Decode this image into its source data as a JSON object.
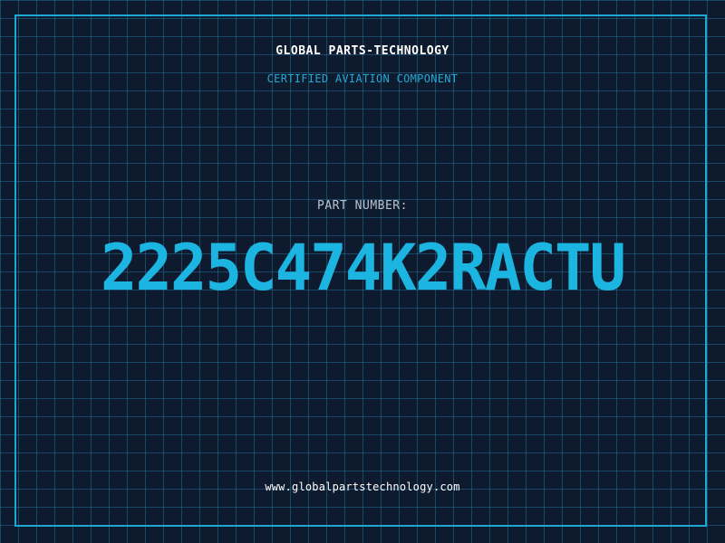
{
  "header": {
    "brand": "GLOBAL PARTS-TECHNOLOGY",
    "tagline": "CERTIFIED AVIATION COMPONENT"
  },
  "part": {
    "label": "PART NUMBER:",
    "number": "2225C474K2RACTU"
  },
  "footer": {
    "website": "www.globalpartstechnology.com"
  },
  "colors": {
    "background": "#0e1a2e",
    "grid": "#286e96",
    "frame": "#1fa7d4",
    "accent": "#1cb4e0",
    "label": "#b9c3cf",
    "text": "#ffffff"
  }
}
